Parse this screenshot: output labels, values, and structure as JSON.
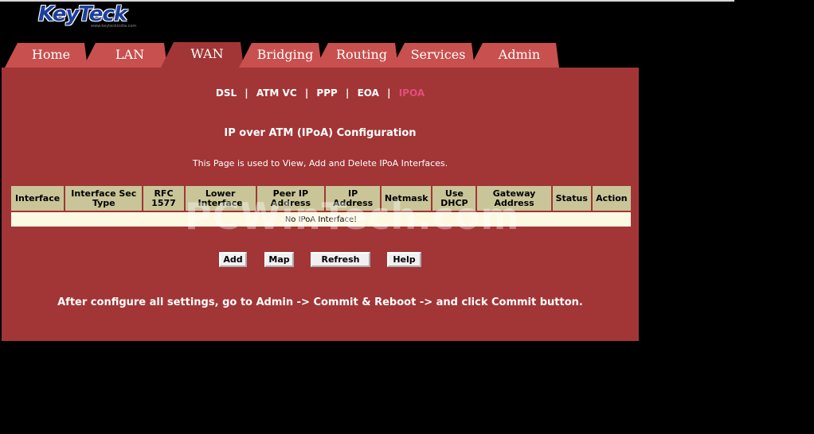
{
  "logo": {
    "text": "KeyTeck",
    "subtext": "www.keyteckindia.com"
  },
  "tabs": [
    {
      "label": "Home"
    },
    {
      "label": "LAN"
    },
    {
      "label": "WAN"
    },
    {
      "label": "Bridging"
    },
    {
      "label": "Routing"
    },
    {
      "label": "Services"
    },
    {
      "label": "Admin"
    }
  ],
  "active_tab": "WAN",
  "subnav": [
    {
      "label": "DSL"
    },
    {
      "label": "ATM VC"
    },
    {
      "label": "PPP"
    },
    {
      "label": "EOA"
    },
    {
      "label": "IPOA"
    }
  ],
  "subnav_separator": "|",
  "active_subnav": "IPOA",
  "page": {
    "title": "IP over ATM (IPoA) Configuration",
    "description": "This Page is used to View, Add and Delete IPoA Interfaces."
  },
  "table": {
    "headers": [
      "Interface",
      "Interface Sec Type",
      "RFC 1577",
      "Lower Interface",
      "Peer IP Address",
      "IP Address",
      "Netmask",
      "Use DHCP",
      "Gateway Address",
      "Status",
      "Action"
    ],
    "empty_message": "No IPoA Interface!"
  },
  "buttons": {
    "add": "Add",
    "map": "Map",
    "refresh": "Refresh",
    "help": "Help"
  },
  "note": "After configure all settings, go to Admin -> Commit & Reboot -> and click Commit button.",
  "watermark": "PCWinTech.com",
  "colors": {
    "background": "#000000",
    "panel": "#a23536",
    "tab": "#c8504e",
    "table_header": "#c9c598",
    "table_row": "#fdf8e2",
    "active_subnav": "#e0507a",
    "logo": "#1c3f9e"
  }
}
